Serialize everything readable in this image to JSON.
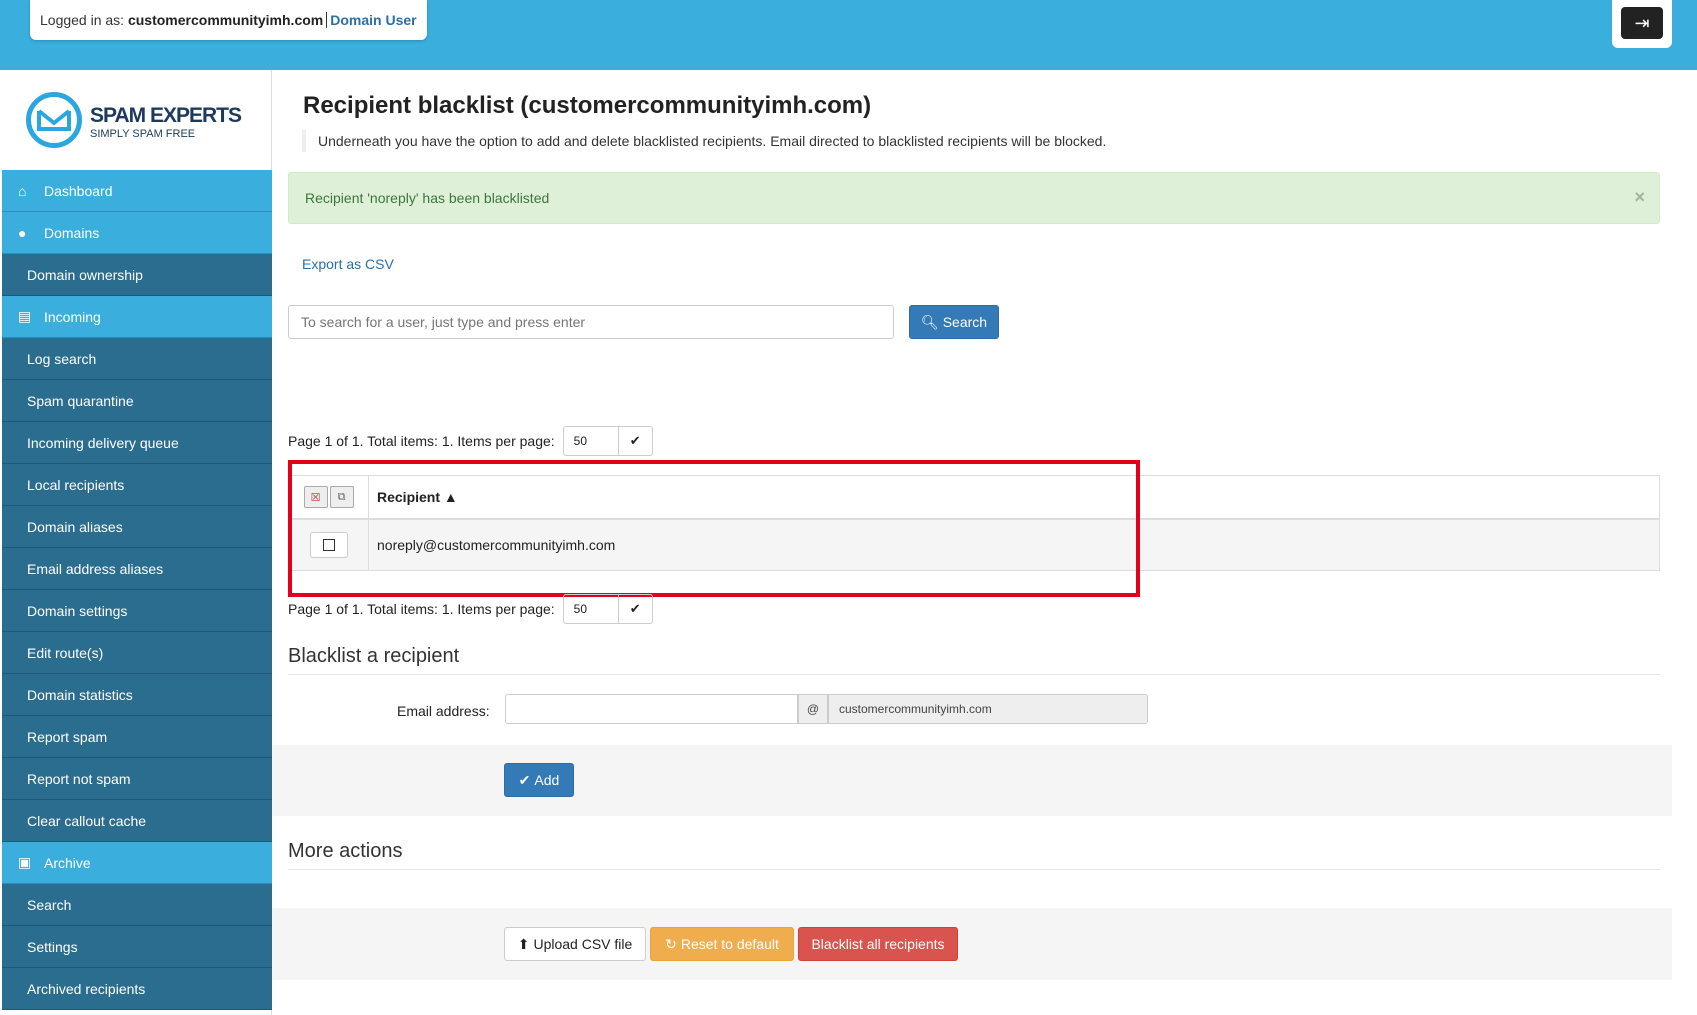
{
  "header": {
    "logged_in_label": "Logged in as:",
    "user": "customercommunityimh.com",
    "role": "Domain User",
    "logout_icon": "logout-icon"
  },
  "logo": {
    "title": "SPAM EXPERTS",
    "subtitle": "SIMPLY SPAM FREE"
  },
  "sidebar": {
    "items": [
      {
        "label": "Dashboard",
        "type": "head",
        "icon": "home-icon"
      },
      {
        "label": "Domains",
        "type": "head",
        "icon": "globe-icon"
      },
      {
        "label": "Domain ownership",
        "type": "sub"
      },
      {
        "label": "Incoming",
        "type": "head",
        "icon": "inbox-icon"
      },
      {
        "label": "Log search",
        "type": "sub"
      },
      {
        "label": "Spam quarantine",
        "type": "sub"
      },
      {
        "label": "Incoming delivery queue",
        "type": "sub"
      },
      {
        "label": "Local recipients",
        "type": "sub"
      },
      {
        "label": "Domain aliases",
        "type": "sub"
      },
      {
        "label": "Email address aliases",
        "type": "sub"
      },
      {
        "label": "Domain settings",
        "type": "sub"
      },
      {
        "label": "Edit route(s)",
        "type": "sub"
      },
      {
        "label": "Domain statistics",
        "type": "sub"
      },
      {
        "label": "Report spam",
        "type": "sub"
      },
      {
        "label": "Report not spam",
        "type": "sub"
      },
      {
        "label": "Clear callout cache",
        "type": "sub"
      },
      {
        "label": "Archive",
        "type": "head",
        "icon": "folder-open-icon"
      },
      {
        "label": "Search",
        "type": "sub"
      },
      {
        "label": "Settings",
        "type": "sub"
      },
      {
        "label": "Archived recipients",
        "type": "sub"
      }
    ]
  },
  "main": {
    "title": "Recipient blacklist (customercommunityimh.com)",
    "description": "Underneath you have the option to add and delete blacklisted recipients. Email directed to blacklisted recipients will be blocked.",
    "alert": "Recipient 'noreply' has been blacklisted",
    "alert_close": "×",
    "export_csv": "Export as CSV",
    "search_placeholder": "To search for a user, just type and press enter",
    "search_button": "Search",
    "pager_text": "Page 1 of 1. Total items: 1. Items per page:",
    "items_per_page": "50",
    "table": {
      "column_header": "Recipient ▲",
      "rows": [
        "noreply@customercommunityimh.com"
      ]
    },
    "blacklist_section": "Blacklist a recipient",
    "email_label": "Email address:",
    "at_symbol": "@",
    "domain": "customercommunityimh.com",
    "add_button": "Add",
    "more_actions": "More actions",
    "upload_csv": "Upload CSV file",
    "reset_default": "Reset to default",
    "blacklist_all": "Blacklist all recipients"
  },
  "colors": {
    "topbar": "#3aaedc",
    "nav_head": "#3aaedc",
    "nav_sub": "#2b6d8e",
    "primary": "#337ab7",
    "warning": "#f0ad4e",
    "danger": "#d9534f",
    "highlight_box": "#e3001b"
  }
}
